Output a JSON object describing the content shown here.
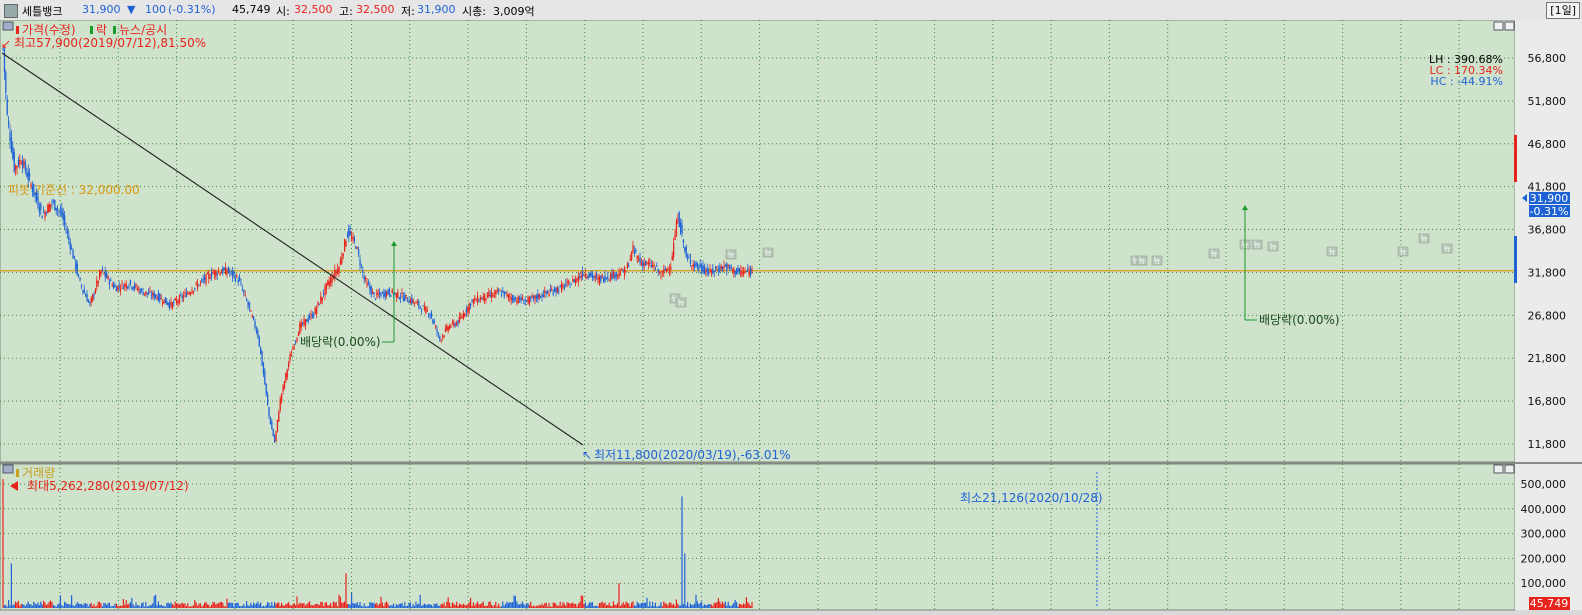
{
  "header": {
    "stock_name": "세틀뱅크",
    "price": "31,900",
    "change_arrow": "▼",
    "change": "100",
    "change_pct": "(-0.31%)",
    "volume": "45,749",
    "open_label": "시:",
    "open": "32,500",
    "high_label": "고:",
    "high": "32,500",
    "low_label": "저:",
    "low": "31,900",
    "mcap_label": "시총:",
    "mcap": "3,009억",
    "period": "[1일]"
  },
  "colors": {
    "plot_bg": "#cfe2cc",
    "up": "#e8231c",
    "down": "#1f62d6",
    "pivot": "#e0a020"
  },
  "price_panel": {
    "legend": {
      "price": "가격(수정)",
      "ex_div": "락",
      "news": "뉴스/공시"
    },
    "high_note": "최고57,900(2019/07/12),81.50%",
    "low_note": "최저11,800(2020/03/19),-63.01%",
    "pivot_label": "피봇 기준선 : 32,000.00",
    "stats": {
      "lh": "LH : 390.68%",
      "lc": "LC : 170.34%",
      "hc": "HC : -44.91%"
    },
    "ex_div_label_1": "배당락(0.00%)",
    "ex_div_label_2": "배당락(0.00%)",
    "current_price_tag": "31,900",
    "current_change_tag": "-0.31%",
    "y_ticks": [
      "56,800",
      "51,800",
      "46,800",
      "41,800",
      "36,800",
      "31,800",
      "26,800",
      "21,800",
      "16,800",
      "11,800"
    ],
    "news_tag": "뉴"
  },
  "volume_panel": {
    "legend": "거래량",
    "max_note": "최대5,262,280(2019/07/12)",
    "min_note": "최소21,126(2020/10/28)",
    "y_ticks": [
      "500,000",
      "400,000",
      "300,000",
      "200,000",
      "100,000"
    ],
    "current_volume_tag": "45,749"
  },
  "chart_data": {
    "type": "candlestick",
    "price_axis": {
      "min": 11800,
      "max": 56800,
      "ticks": [
        56800,
        51800,
        46800,
        41800,
        36800,
        31800,
        26800,
        21800,
        16800,
        11800
      ]
    },
    "volume_axis": {
      "max": 500000,
      "ticks": [
        500000,
        400000,
        300000,
        200000,
        100000
      ]
    },
    "pivot": 32000,
    "period_max": {
      "price": 57900,
      "date": "2019/07/12"
    },
    "period_min": {
      "price": 11800,
      "date": "2020/03/19"
    },
    "last": {
      "price": 31900,
      "volume": 45749
    },
    "price_path": [
      [
        0,
        57900
      ],
      [
        3,
        50000
      ],
      [
        8,
        44000
      ],
      [
        13,
        45000
      ],
      [
        20,
        42000
      ],
      [
        28,
        38500
      ],
      [
        35,
        40000
      ],
      [
        42,
        38500
      ],
      [
        48,
        35000
      ],
      [
        55,
        30500
      ],
      [
        62,
        28000
      ],
      [
        70,
        32000
      ],
      [
        80,
        30000
      ],
      [
        90,
        30500
      ],
      [
        100,
        29500
      ],
      [
        110,
        29000
      ],
      [
        120,
        28000
      ],
      [
        130,
        29200
      ],
      [
        140,
        30500
      ],
      [
        150,
        31800
      ],
      [
        160,
        32000
      ],
      [
        168,
        31000
      ],
      [
        175,
        28000
      ],
      [
        182,
        24500
      ],
      [
        186,
        20000
      ],
      [
        190,
        15000
      ],
      [
        194,
        12000
      ],
      [
        198,
        17000
      ],
      [
        205,
        22000
      ],
      [
        212,
        25500
      ],
      [
        222,
        27000
      ],
      [
        232,
        30500
      ],
      [
        240,
        32500
      ],
      [
        246,
        36500
      ],
      [
        252,
        35000
      ],
      [
        258,
        31000
      ],
      [
        265,
        29000
      ],
      [
        275,
        29500
      ],
      [
        285,
        29000
      ],
      [
        295,
        28200
      ],
      [
        305,
        27000
      ],
      [
        312,
        24000
      ],
      [
        318,
        25500
      ],
      [
        325,
        26000
      ],
      [
        335,
        28500
      ],
      [
        345,
        29000
      ],
      [
        355,
        29500
      ],
      [
        365,
        28700
      ],
      [
        375,
        28500
      ],
      [
        385,
        29200
      ],
      [
        395,
        29800
      ],
      [
        405,
        30500
      ],
      [
        415,
        31800
      ],
      [
        425,
        31000
      ],
      [
        435,
        31500
      ],
      [
        445,
        32000
      ],
      [
        450,
        34500
      ],
      [
        455,
        33000
      ],
      [
        465,
        32500
      ],
      [
        470,
        31500
      ],
      [
        477,
        32800
      ],
      [
        482,
        38500
      ],
      [
        488,
        33500
      ],
      [
        495,
        32500
      ],
      [
        505,
        31800
      ],
      [
        515,
        32500
      ],
      [
        525,
        31800
      ],
      [
        535,
        31900
      ]
    ],
    "volume_spikes": [
      [
        0,
        5262280
      ],
      [
        6,
        180000
      ],
      [
        245,
        140000
      ],
      [
        249,
        60000
      ],
      [
        440,
        100000
      ],
      [
        485,
        450000
      ],
      [
        487,
        220000
      ]
    ],
    "volume_min": {
      "value": 21126,
      "date": "2020/10/28"
    }
  }
}
